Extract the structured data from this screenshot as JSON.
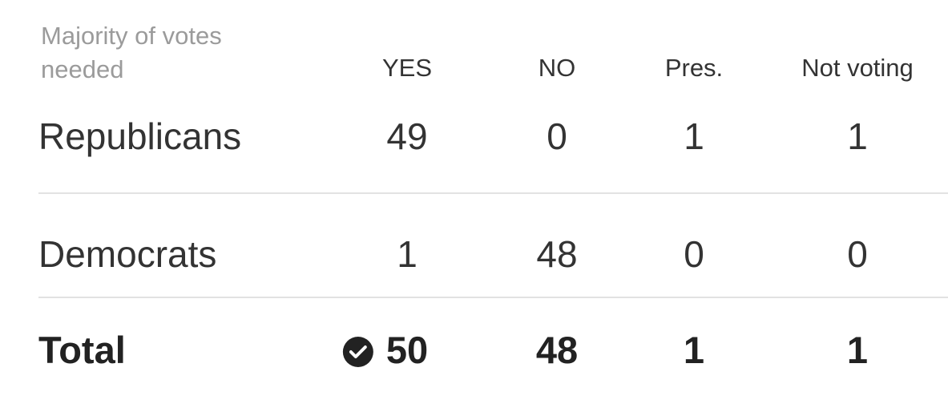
{
  "caption": "Majority of votes needed",
  "columns": {
    "yes": "YES",
    "no": "NO",
    "present": "Pres.",
    "not_voting": "Not voting"
  },
  "rows": [
    {
      "label": "Republicans",
      "yes": "49",
      "no": "0",
      "present": "1",
      "not_voting": "1"
    },
    {
      "label": "Democrats",
      "yes": "1",
      "no": "48",
      "present": "0",
      "not_voting": "0"
    }
  ],
  "total": {
    "label": "Total",
    "yes": "50",
    "no": "48",
    "present": "1",
    "not_voting": "1",
    "yes_status_icon": "check-circle-icon"
  },
  "colors": {
    "text": "#333333",
    "muted": "#9b9b9b",
    "divider": "#e2e2e2",
    "badge": "#222222"
  }
}
